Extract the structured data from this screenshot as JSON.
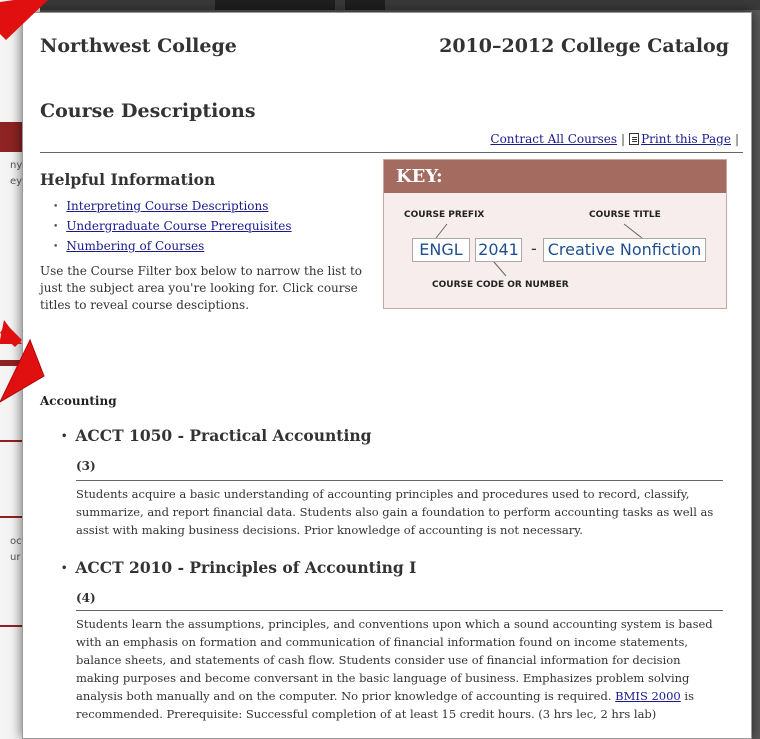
{
  "header": {
    "college": "Northwest College",
    "catalog": "2010–2012 College Catalog"
  },
  "page_title": "Course Descriptions",
  "toolbar": {
    "contract": "Contract All Courses",
    "separator": "|",
    "print": "Print this Page",
    "trailing": "|"
  },
  "helpful": {
    "title": "Helpful Information",
    "links": [
      "Interpreting Course Descriptions",
      "Undergraduate Course Prerequisites",
      "Numbering of Courses"
    ],
    "note": "Use the Course Filter box below to narrow the list to just the subject area you're looking for. Click course titles to reveal course desciptions."
  },
  "key": {
    "title": "KEY:",
    "prefix_label": "COURSE PREFIX",
    "title_label": "COURSE TITLE",
    "code_label": "COURSE CODE OR NUMBER",
    "prefix": "ENGL",
    "code": "2041",
    "dash": "-",
    "course_title": "Creative Nonfiction"
  },
  "section": "Accounting",
  "courses": [
    {
      "title": "ACCT 1050 - Practical Accounting",
      "credits": "(3)",
      "desc": "Students acquire a basic understanding of accounting principles and procedures used to record, classify, summarize, and report financial data. Students also gain a foundation to perform accounting tasks as well as assist with making business decisions. Prior knowledge of accounting is not necessary."
    },
    {
      "title": "ACCT 2010 - Principles of Accounting I",
      "credits": "(4)",
      "desc_before": "Students learn the assumptions, principles, and conventions upon which a sound accounting system is based with an emphasis on formation and communication of financial information found on income statements, balance sheets, and statements of cash flow. Students consider use of financial information for decision making purposes and become conversant in the basic language of business. Emphasizes problem solving analysis both manually and on the computer. No prior knowledge of accounting is required. ",
      "desc_link": "BMIS 2000",
      "desc_after": " is recommended. Prerequisite: Successful completion of at least 15 credit hours. (3 hrs lec, 2 hrs lab)"
    }
  ],
  "background_fragments": [
    "ny",
    "ey",
    "oc",
    "ur"
  ],
  "colors": {
    "key_header": "#a46b60",
    "key_bg": "#f7eded",
    "link": "#1a1a8f",
    "arrow": "#e01010",
    "key_text": "#1f4f8f"
  }
}
